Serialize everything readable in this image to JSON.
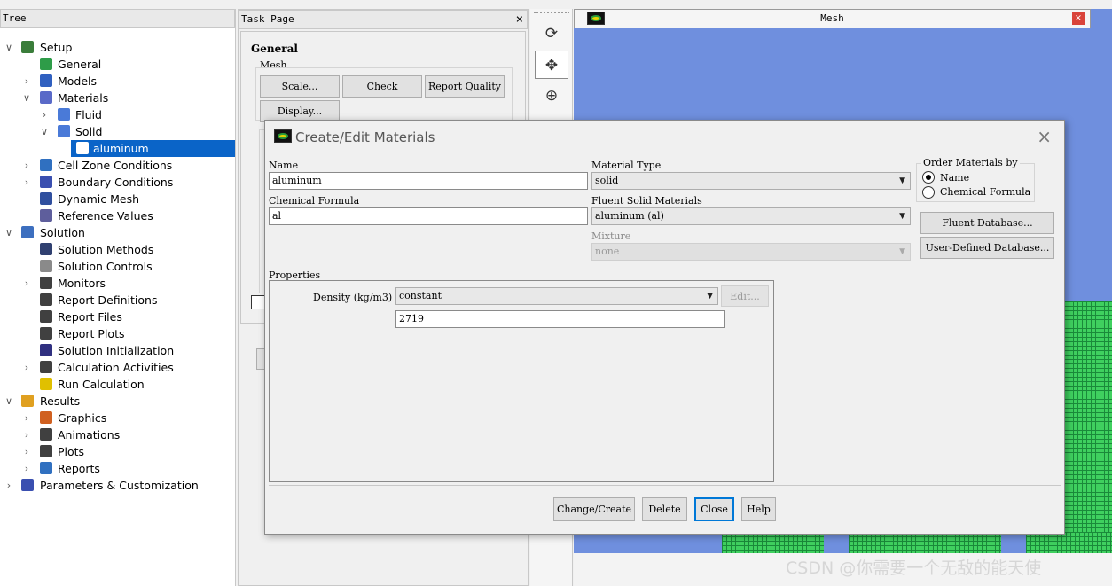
{
  "tree": {
    "header": "Tree",
    "items": [
      {
        "label": "Setup"
      },
      {
        "label": "General"
      },
      {
        "label": "Models"
      },
      {
        "label": "Materials"
      },
      {
        "label": "Fluid"
      },
      {
        "label": "Solid"
      },
      {
        "label": "aluminum"
      },
      {
        "label": "Cell Zone Conditions"
      },
      {
        "label": "Boundary Conditions"
      },
      {
        "label": "Dynamic Mesh"
      },
      {
        "label": "Reference Values"
      },
      {
        "label": "Solution"
      },
      {
        "label": "Solution Methods"
      },
      {
        "label": "Solution Controls"
      },
      {
        "label": "Monitors"
      },
      {
        "label": "Report Definitions"
      },
      {
        "label": "Report Files"
      },
      {
        "label": "Report Plots"
      },
      {
        "label": "Solution Initialization"
      },
      {
        "label": "Calculation Activities"
      },
      {
        "label": "Run Calculation"
      },
      {
        "label": "Results"
      },
      {
        "label": "Graphics"
      },
      {
        "label": "Animations"
      },
      {
        "label": "Plots"
      },
      {
        "label": "Reports"
      },
      {
        "label": "Parameters & Customization"
      }
    ]
  },
  "task_page": {
    "header": "Task Page",
    "close": "×",
    "section_title": "General",
    "mesh_group": "Mesh",
    "buttons": {
      "scale": "Scale...",
      "check": "Check",
      "report_quality": "Report Quality",
      "display": "Display..."
    }
  },
  "mesh_window": {
    "title": "Mesh",
    "close": "×"
  },
  "dialog": {
    "title": "Create/Edit Materials",
    "close": "×",
    "name_label": "Name",
    "name_value": "aluminum",
    "formula_label": "Chemical Formula",
    "formula_value": "al",
    "material_type_label": "Material Type",
    "material_type_value": "solid",
    "fluent_solid_label": "Fluent Solid Materials",
    "fluent_solid_value": "aluminum (al)",
    "mixture_label": "Mixture",
    "mixture_value": "none",
    "order_label": "Order Materials by",
    "order_options": [
      "Name",
      "Chemical Formula"
    ],
    "order_selected": "Name",
    "fluent_db_button": "Fluent Database...",
    "user_db_button": "User-Defined Database...",
    "properties_label": "Properties",
    "density_label": "Density (kg/m3)",
    "density_method": "constant",
    "edit_button": "Edit...",
    "density_value": "2719",
    "buttons": {
      "change_create": "Change/Create",
      "delete": "Delete",
      "close": "Close",
      "help": "Help"
    }
  },
  "watermark": "CSDN @你需要一个无敌的能天使",
  "colors": {
    "selection": "#0a64c8",
    "viewport": "#6f8fde",
    "mesh": "#3fd05f"
  }
}
